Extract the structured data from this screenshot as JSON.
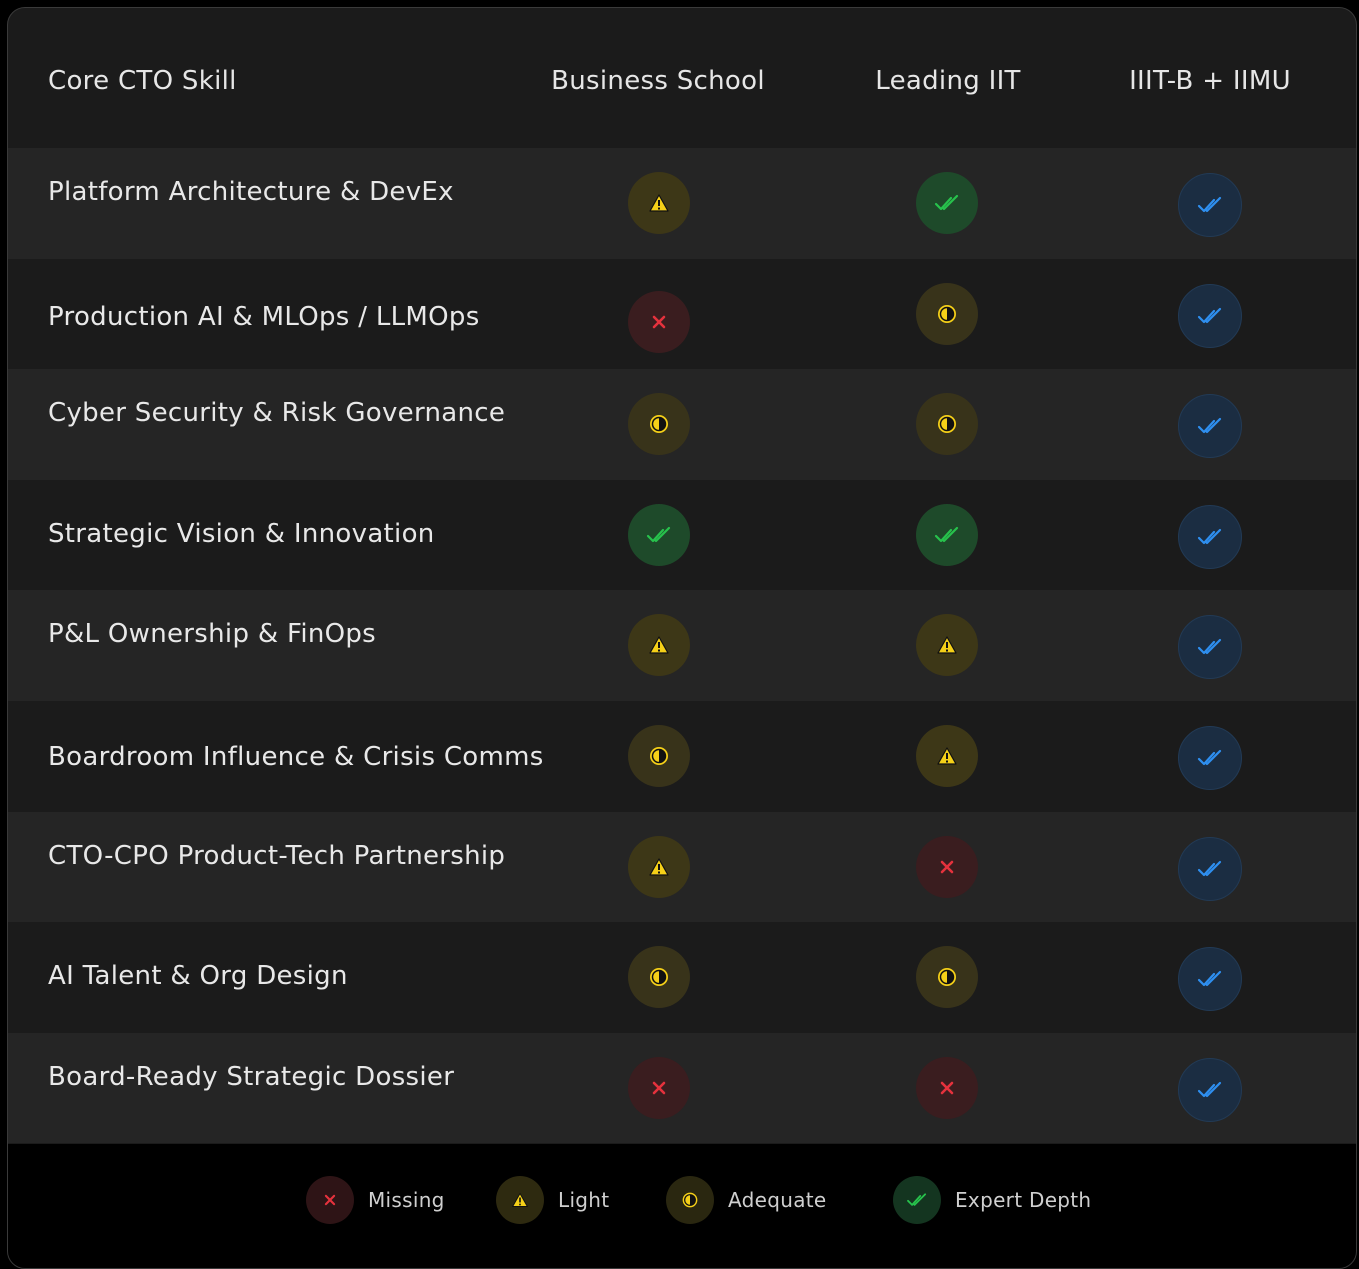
{
  "table": {
    "headers": [
      "Core CTO Skill",
      "Business School",
      "Leading IIT",
      "IIIT-B + IIMU"
    ],
    "rows": [
      {
        "label": "Platform Architecture & DevEx",
        "cells": [
          "light",
          "expert",
          "expert-blue"
        ]
      },
      {
        "label": "Production AI & MLOps / LLMOps",
        "cells": [
          "missing",
          "adequate",
          "expert-blue"
        ]
      },
      {
        "label": "Cyber Security & Risk Governance",
        "cells": [
          "adequate",
          "adequate",
          "expert-blue"
        ]
      },
      {
        "label": "Strategic Vision & Innovation",
        "cells": [
          "expert",
          "expert",
          "expert-blue"
        ]
      },
      {
        "label": "P&L Ownership & FinOps",
        "cells": [
          "light",
          "light",
          "expert-blue"
        ]
      },
      {
        "label": "Boardroom Influence & Crisis Comms",
        "cells": [
          "adequate",
          "light",
          "expert-blue"
        ]
      },
      {
        "label": "CTO-CPO Product-Tech Partnership",
        "cells": [
          "light",
          "missing",
          "expert-blue"
        ]
      },
      {
        "label": "AI Talent & Org Design",
        "cells": [
          "adequate",
          "adequate",
          "expert-blue"
        ]
      },
      {
        "label": "Board-Ready Strategic Dossier",
        "cells": [
          "missing",
          "missing",
          "expert-blue"
        ]
      }
    ]
  },
  "legend": [
    {
      "key": "missing",
      "label": "Missing",
      "icon": "x-icon"
    },
    {
      "key": "light",
      "label": "Light",
      "icon": "warning-icon"
    },
    {
      "key": "adequate",
      "label": "Adequate",
      "icon": "half-circle-icon"
    },
    {
      "key": "expert",
      "label": "Expert Depth",
      "icon": "double-check-icon"
    }
  ],
  "colors": {
    "missing": "#e5323d",
    "light": "#f5d018",
    "adequate": "#f5d018",
    "expert": "#27c24c",
    "expert_blue": "#2e8ff0"
  }
}
